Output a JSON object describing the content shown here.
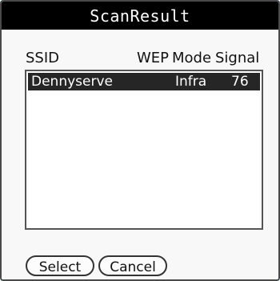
{
  "dialog": {
    "title": "ScanResult"
  },
  "columns": {
    "ssid": "SSID",
    "wep": "WEP",
    "mode": "Mode",
    "signal": "Signal"
  },
  "results": [
    {
      "ssid": "Dennyserve",
      "wep": "",
      "mode": "Infra",
      "signal": "76",
      "selected": true
    }
  ],
  "buttons": {
    "select_label": "Select",
    "cancel_label": "Cancel"
  },
  "colors": {
    "titlebar": "#000000",
    "selection": "#262626",
    "background": "#f8f8f8"
  }
}
